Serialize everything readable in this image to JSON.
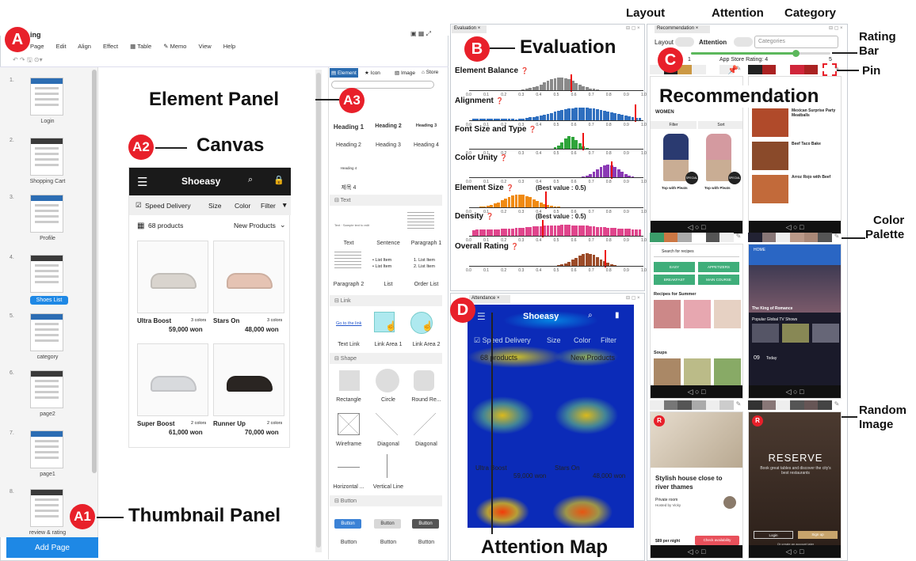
{
  "badges": {
    "a": "A",
    "a1": "A1",
    "a2": "A2",
    "a3": "A3",
    "b": "B",
    "c": "C",
    "d": "D",
    "r": "R"
  },
  "callouts": {
    "element_panel": "Element Panel",
    "canvas": "Canvas",
    "thumbnail_panel": "Thumbnail Panel",
    "evaluation": "Evaluation",
    "recommendation": "Recommendation",
    "attention_map": "Attention Map",
    "layout": "Layout",
    "attention": "Attention",
    "category": "Category",
    "rating_bar": "Rating\nBar",
    "pin": "Pin",
    "color_palette": "Color\nPalette",
    "random_image": "Random\nImage"
  },
  "app": {
    "title": "ing",
    "menu": [
      "Page",
      "Edit",
      "Align",
      "Effect",
      "Table",
      "Memo",
      "View",
      "Help"
    ]
  },
  "thumbnails": [
    {
      "num": "1.",
      "label": "Login"
    },
    {
      "num": "2.",
      "label": "Shopping Cart"
    },
    {
      "num": "3.",
      "label": "Profile"
    },
    {
      "num": "4.",
      "label": "Shoes List"
    },
    {
      "num": "5.",
      "label": "category"
    },
    {
      "num": "6.",
      "label": "page2"
    },
    {
      "num": "7.",
      "label": "page1"
    },
    {
      "num": "8.",
      "label": "review & rating"
    }
  ],
  "add_page": "Add Page",
  "canvas": {
    "brand": "Shoeasy",
    "speed_delivery": "Speed Delivery",
    "size": "Size",
    "color": "Color",
    "filter": "Filter",
    "count": "68 products",
    "sort": "New Products",
    "products": [
      {
        "name": "Ultra Boost",
        "colors": "3 colors",
        "price": "59,000 won"
      },
      {
        "name": "Stars On",
        "colors": "3 colors",
        "price": "48,000 won"
      },
      {
        "name": "Super Boost",
        "colors": "2 colors",
        "price": "61,000 won"
      },
      {
        "name": "Runner Up",
        "colors": "2 colors",
        "price": "70,000 won"
      }
    ]
  },
  "element_panel": {
    "tabs": [
      "Element",
      "Icon",
      "Image",
      "Store"
    ],
    "headings": [
      "Heading 1",
      "Heading 2",
      "Heading 3",
      "Heading 2",
      "Heading 3",
      "Heading 4",
      "Heading 4",
      "제목 4"
    ],
    "sections": {
      "text": "⊟ Text",
      "link": "⊟ Link",
      "shape": "⊟ Shape",
      "button": "⊟ Button"
    },
    "text_items": [
      "Text",
      "Sentence",
      "Paragraph 1",
      "Paragraph 2",
      "List",
      "Order List"
    ],
    "list_lines": [
      "• List Item",
      "• List Item",
      "1. List Item",
      "2. List Item"
    ],
    "text_sample": "Text · Sample text to edit",
    "link_items": [
      "Text Link",
      "Link Area 1",
      "Link Area 2"
    ],
    "link_sample": "Go to the link",
    "shape_items": [
      "Rectangle",
      "Circle",
      "Round Re...",
      "Wireframe",
      "Diagonal",
      "Diagonal",
      "Horizontal ...",
      "Vertical Line"
    ],
    "button_items": [
      "Button",
      "Button",
      "Button"
    ],
    "button_caption": "Button"
  },
  "evaluation": {
    "tab": "Evaluation",
    "metrics": [
      {
        "label": "Element Balance",
        "note": "",
        "color": "#8a8a8a",
        "marker": 0.58
      },
      {
        "label": "Alignment",
        "note": "",
        "color": "#2f6fbf",
        "marker": 0.96
      },
      {
        "label": "Font Size and Type",
        "note": "",
        "color": "#2ea43a",
        "marker": 0.65
      },
      {
        "label": "Color Unity",
        "note": "",
        "color": "#8b3ab5",
        "marker": 0.82
      },
      {
        "label": "Element Size",
        "note": "(Best value : 0.5)",
        "color": "#f08a12",
        "marker": 0.43
      },
      {
        "label": "Density",
        "note": "(Best value : 0.5)",
        "color": "#e0458c",
        "marker": 0.41
      },
      {
        "label": "Overall Rating",
        "note": "",
        "color": "#9c4b28",
        "marker": 0.78
      }
    ],
    "ticks": [
      "0.0",
      "0.1",
      "0.2",
      "0.3",
      "0.4",
      "0.5",
      "0.6",
      "0.7",
      "0.8",
      "0.9",
      "1.0"
    ]
  },
  "recommendation": {
    "tab": "Recommendation",
    "layout_toggle": "Layout",
    "attention_toggle": "Attention",
    "categories_placeholder": "Categories",
    "rating_label": "App Store Rating: 4",
    "rating_min": "1",
    "rating_max": "5",
    "rating_value": 0.75,
    "women": "WOMEN",
    "filter": "Filter",
    "sort": "Sort",
    "top_item": "Top with Pleats",
    "special": "SPECIAL",
    "recipes": [
      "Mexican Surprise Party Meatballs",
      "Beef Taco Bake",
      "Arroz Rojo with Beef"
    ],
    "recipe_search": "Search for recipes",
    "recipe_tags": [
      "EASY",
      "APPETIZERS",
      "BREAKFAST",
      "MAIN COURSE"
    ],
    "recipes_summer": "Recipes for Summer",
    "soups": "Soups",
    "tv_home": "HOME",
    "tv_title": "The King of Romance",
    "tv_popular": "Popular Global TV Shows",
    "tv_today": "Today",
    "tv_date": "09",
    "house_title": "Stylish house close to river thames",
    "house_host": "Private room",
    "house_hosted_by": "Hosted by Vicky",
    "house_price": "$89 per night",
    "house_cta": "Check availability",
    "reserve_title": "RESERVE",
    "reserve_sub": "Book great tables and discover the city's best restaurants",
    "reserve_login": "Login",
    "reserve_signup": "Sign up",
    "reserve_create": "Or create an account later"
  },
  "attention": {
    "tab": "Attendance"
  },
  "colors": {
    "accent_red": "#e8202a",
    "nav_dark": "#1a1a1a",
    "add_page_blue": "#1e88e5"
  }
}
